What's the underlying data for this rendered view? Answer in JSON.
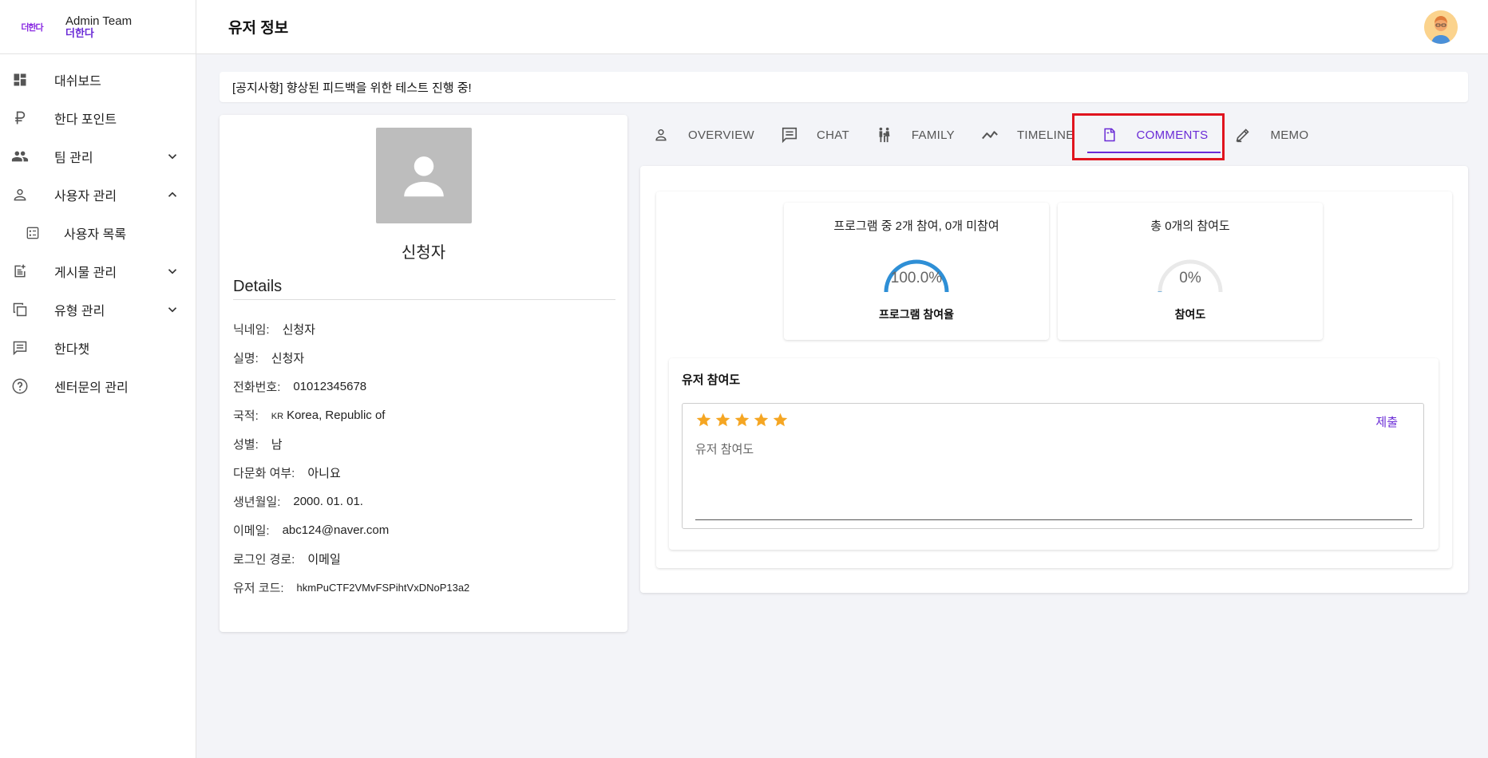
{
  "brand": {
    "logo_text": "더한다",
    "title": "Admin Team",
    "subtitle": "더한다"
  },
  "sidebar": {
    "items": [
      {
        "label": "대쉬보드",
        "icon": "dashboard-icon"
      },
      {
        "label": "한다 포인트",
        "icon": "ruble-icon"
      },
      {
        "label": "팀 관리",
        "icon": "people-icon",
        "expanded": false
      },
      {
        "label": "사용자 관리",
        "icon": "person-icon",
        "expanded": true
      },
      {
        "label": "사용자 목록",
        "icon": "list-icon",
        "sub": true
      },
      {
        "label": "게시물 관리",
        "icon": "post-add-icon",
        "expanded": false
      },
      {
        "label": "유형 관리",
        "icon": "copy-icon",
        "expanded": false
      },
      {
        "label": "한다챗",
        "icon": "chat-icon"
      },
      {
        "label": "센터문의 관리",
        "icon": "help-icon"
      }
    ]
  },
  "header": {
    "title": "유저 정보"
  },
  "notice": "[공지사항] 향상된 피드백을 위한 테스트 진행 중!",
  "profile": {
    "name": "신청자",
    "details_title": "Details",
    "fields": [
      {
        "label": "닉네임:",
        "value": "신청자"
      },
      {
        "label": "실명:",
        "value": "신청자"
      },
      {
        "label": "전화번호:",
        "value": "01012345678"
      },
      {
        "label": "국적:",
        "flag": "KR",
        "value": "Korea, Republic of"
      },
      {
        "label": "성별:",
        "value": "남"
      },
      {
        "label": "다문화 여부:",
        "value": "아니요"
      },
      {
        "label": "생년월일:",
        "value": "2000. 01. 01."
      },
      {
        "label": "이메일:",
        "value": "abc124@naver.com"
      },
      {
        "label": "로그인 경로:",
        "value": "이메일"
      },
      {
        "label": "유저 코드:",
        "value": "hkmPuCTF2VMvFSPihtVxDNoP13a2"
      }
    ]
  },
  "tabs": [
    {
      "label": "OVERVIEW",
      "icon": "person-outline-icon"
    },
    {
      "label": "CHAT",
      "icon": "chat-icon"
    },
    {
      "label": "FAMILY",
      "icon": "family-icon"
    },
    {
      "label": "TIMELINE",
      "icon": "timeline-icon"
    },
    {
      "label": "COMMENTS",
      "icon": "note-icon",
      "active": true
    },
    {
      "label": "MEMO",
      "icon": "edit-icon"
    }
  ],
  "stats": [
    {
      "top": "프로그램 중 2개 참여, 0개 미참여",
      "value": "100.0%",
      "progress": 1.0,
      "bottom": "프로그램 참여율",
      "color": "#2e8fd6"
    },
    {
      "top": "총 0개의 참여도",
      "value": "0%",
      "progress": 0.0,
      "bottom": "참여도",
      "color": "#2e8fd6"
    }
  ],
  "rating": {
    "title": "유저 참여도",
    "stars": 5,
    "star_color": "#f5a623",
    "submit_label": "제출",
    "comment_placeholder": "유저 참여도"
  }
}
